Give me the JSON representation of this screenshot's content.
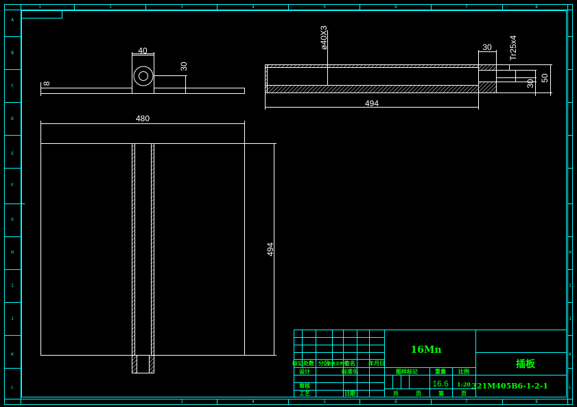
{
  "zones": {
    "top": [
      "1",
      "2",
      "3",
      "4",
      "5",
      "6",
      "7",
      "8"
    ],
    "bottom": [
      "3",
      "4",
      "5",
      "6",
      "7",
      "8"
    ],
    "rows": [
      "A",
      "B",
      "C",
      "D",
      "E",
      "F",
      "G",
      "H",
      "I",
      "J",
      "K",
      "L"
    ]
  },
  "dimensions": {
    "width_40": "40",
    "height_30_side": "30",
    "thickness_8": "8",
    "tube_spec": "ø40X3",
    "thread_len_30": "30",
    "thread_spec": "Tr25x4",
    "dia_30": "30",
    "dia_50": "50",
    "tube_len": "494",
    "plate_width": "480",
    "plate_height": "494"
  },
  "title_block": {
    "material": "16Mn",
    "part_name": "插板",
    "drawing_no": "321M405B6-1-2-1",
    "weight": "16.6",
    "scale": "1:20",
    "rev_headers": [
      "标记",
      "处数",
      "分区",
      "更改文件号",
      "签名",
      "年月日"
    ],
    "row_design": "设计",
    "row_standard": "标准化",
    "row_review": "审核",
    "row_process": "工艺",
    "row_date": "日期",
    "stage_mark": "图样标记",
    "weight_label": "重量",
    "scale_label": "比例",
    "sheets_total": "共",
    "sheets_unit": "页",
    "sheet_no": "第",
    "sheet_unit": "页"
  },
  "colors": {
    "border": "#00ffff",
    "geometry": "#ffffff",
    "title_text": "#00ff00",
    "background": "#000000"
  }
}
